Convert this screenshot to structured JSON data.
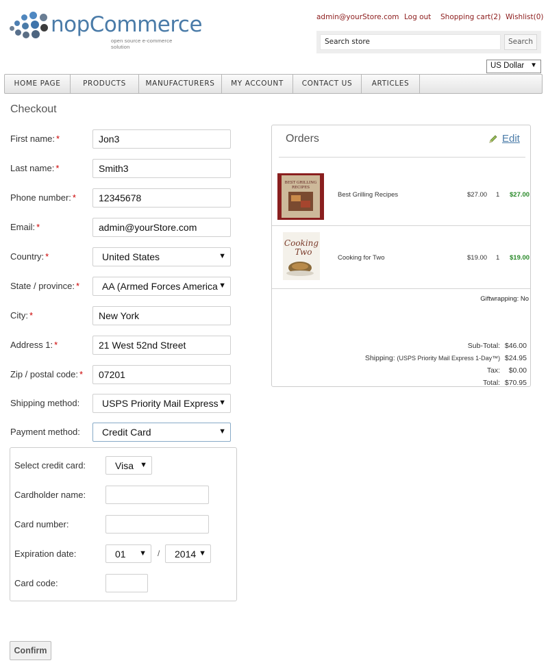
{
  "brand": {
    "name": "nopCommerce",
    "tagline": "open source e-commerce solution"
  },
  "header": {
    "links": {
      "account": "admin@yourStore.com",
      "logout": "Log out",
      "cart": "Shopping cart(2)",
      "wishlist": "Wishlist(0)"
    },
    "search": {
      "placeholder": "Search store",
      "button": "Search"
    },
    "currency": "US Dollar"
  },
  "menu": [
    "HOME PAGE",
    "PRODUCTS",
    "MANUFACTURERS",
    "MY ACCOUNT",
    "CONTACT US",
    "ARTICLES"
  ],
  "checkout": {
    "title": "Checkout",
    "fields": [
      {
        "label": "First name:",
        "required": true,
        "value": "Jon3",
        "type": "text"
      },
      {
        "label": "Last name:",
        "required": true,
        "value": "Smith3",
        "type": "text"
      },
      {
        "label": "Phone number:",
        "required": true,
        "value": "12345678",
        "type": "text"
      },
      {
        "label": "Email:",
        "required": true,
        "value": "admin@yourStore.com",
        "type": "text"
      },
      {
        "label": "Country:",
        "required": true,
        "value": "United States",
        "type": "select"
      },
      {
        "label": "State / province:",
        "required": true,
        "value": "AA (Armed Forces America",
        "type": "select"
      },
      {
        "label": "City:",
        "required": true,
        "value": "New York",
        "type": "text"
      },
      {
        "label": "Address 1:",
        "required": true,
        "value": "21 West 52nd Street",
        "type": "text"
      },
      {
        "label": "Zip / postal code:",
        "required": true,
        "value": "07201",
        "type": "text"
      },
      {
        "label": "Shipping method:",
        "required": false,
        "value": "USPS Priority Mail Express",
        "type": "select"
      },
      {
        "label": "Payment method:",
        "required": false,
        "value": "Credit Card",
        "type": "select"
      }
    ],
    "required_mark": "*",
    "credit_card": {
      "select_label": "Select credit card:",
      "card_type": "Visa",
      "holder_label": "Cardholder name:",
      "holder_value": "",
      "number_label": "Card number:",
      "number_value": "",
      "expiration_label": "Expiration date:",
      "exp_month": "01",
      "exp_separator": "/",
      "exp_year": "2014",
      "code_label": "Card code:",
      "code_value": ""
    },
    "confirm_button": "Confirm"
  },
  "orders": {
    "title": "Orders",
    "edit_label": "Edit",
    "items": [
      {
        "name": "Best Grilling Recipes",
        "price": "$27.00",
        "qty": "1",
        "total": "$27.00"
      },
      {
        "name": "Cooking for Two",
        "price": "$19.00",
        "qty": "1",
        "total": "$19.00"
      }
    ],
    "book_covers": {
      "grilling": {
        "line1": "BEST GRILLING",
        "line2": "RECIPES"
      },
      "cooking": {
        "line1": "Cooking",
        "line2": "Two"
      }
    },
    "giftwrapping": "Giftwrapping: No",
    "subtotal_label": "Sub-Total:",
    "subtotal": "$46.00",
    "shipping_label": "Shipping:",
    "shipping_method": "(USPS Priority Mail Express 1-Day™)",
    "shipping": "$24.95",
    "tax_label": "Tax:",
    "tax": "$0.00",
    "total_label": "Total:",
    "total": "$70.95",
    "colors": {
      "item_total": "#2a8a2a",
      "edit_link": "#4a7ba8"
    }
  },
  "colors": {
    "header_link": "#8b1a1a",
    "required": "#cc0000",
    "brand": "#4a7ba8"
  }
}
